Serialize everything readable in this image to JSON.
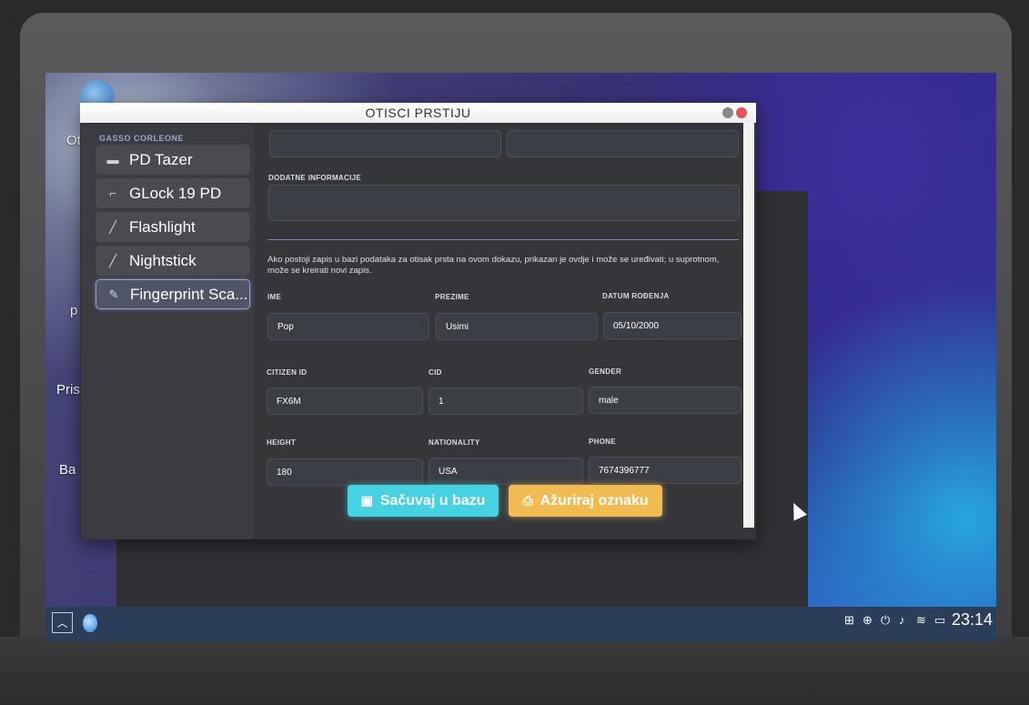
{
  "window": {
    "title": "OTISCI PRSTIJU"
  },
  "desktop": {
    "labels": [
      "Ot",
      "p",
      "Pris",
      "Ba"
    ]
  },
  "sidebar": {
    "title": "GASSO CORLEONE",
    "items": [
      {
        "label": "PD Tazer",
        "icon": "tazer-icon"
      },
      {
        "label": "GLock 19 PD",
        "icon": "pistol-icon"
      },
      {
        "label": "Flashlight",
        "icon": "flashlight-icon"
      },
      {
        "label": "Nightstick",
        "icon": "nightstick-icon"
      },
      {
        "label": "Fingerprint Sca...",
        "icon": "fingerprint-scanner-icon",
        "active": true
      }
    ]
  },
  "form": {
    "top_fields": [
      "",
      ""
    ],
    "extra_info_label": "DODATNE INFORMACIJE",
    "extra_info_value": "",
    "info_text": "Ako postoji zapis u bazi podataka za otisak prsta na ovom dokazu, prikazan je ovdje i može se uređivati; u suprotnom, može se kreirati novi zapis.",
    "labels": {
      "first_name": "IME",
      "last_name": "PREZIME",
      "dob": "DATUM ROĐENJA",
      "citizen_id": "CITIZEN ID",
      "cid": "CID",
      "gender": "GENDER",
      "height": "HEIGHT",
      "nationality": "NATIONALITY",
      "phone": "PHONE"
    },
    "values": {
      "first_name": "Pop",
      "last_name": "Usimi",
      "dob": "05/10/2000",
      "citizen_id": "FX6M",
      "cid": "1",
      "gender": "male",
      "height": "180",
      "nationality": "USA",
      "phone": "7674396777"
    }
  },
  "buttons": {
    "save": "Sačuvaj u bazu",
    "update": "Ažuriraj oznaku"
  },
  "taskbar": {
    "clock": "23:14",
    "tray_icons": [
      "grid-icon",
      "globe-icon",
      "power-icon",
      "volume-icon",
      "wifi-icon",
      "battery-icon"
    ]
  },
  "colors": {
    "save_button": "#46d2e0",
    "update_button": "#f2bb52",
    "close": "#e25454"
  }
}
